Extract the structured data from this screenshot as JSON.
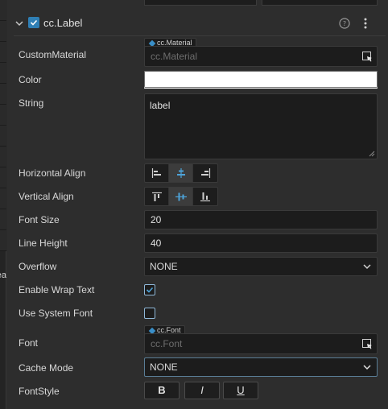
{
  "component": {
    "title": "cc.Label",
    "enabled": true
  },
  "left_fragment": "ea",
  "properties": {
    "custom_material": {
      "label": "CustomMaterial",
      "tag": "cc.Material",
      "placeholder": "cc.Material"
    },
    "color": {
      "label": "Color",
      "value": "#ffffff"
    },
    "string": {
      "label": "String",
      "value": "label"
    },
    "horizontal_align": {
      "label": "Horizontal Align",
      "selected": "center"
    },
    "vertical_align": {
      "label": "Vertical Align",
      "selected": "center"
    },
    "font_size": {
      "label": "Font Size",
      "value": "20"
    },
    "line_height": {
      "label": "Line Height",
      "value": "40"
    },
    "overflow": {
      "label": "Overflow",
      "value": "NONE"
    },
    "enable_wrap_text": {
      "label": "Enable Wrap Text",
      "checked": true
    },
    "use_system_font": {
      "label": "Use System Font",
      "checked": false
    },
    "font": {
      "label": "Font",
      "tag": "cc.Font",
      "placeholder": "cc.Font"
    },
    "cache_mode": {
      "label": "Cache Mode",
      "value": "NONE"
    },
    "font_style": {
      "label": "FontStyle",
      "bold": "B",
      "italic": "I",
      "underline": "U"
    }
  },
  "colors": {
    "accent": "#2f7fb5",
    "active_icon": "#4da3d9",
    "panel_bg": "#2d2d2d",
    "field_bg": "#1c1c1c"
  },
  "icons": {
    "collapse": "chevron-down-icon",
    "help": "help-circle-icon",
    "more": "more-vertical-icon",
    "asset_picker": "asset-picker-icon",
    "dropdown": "chevron-down-icon"
  }
}
